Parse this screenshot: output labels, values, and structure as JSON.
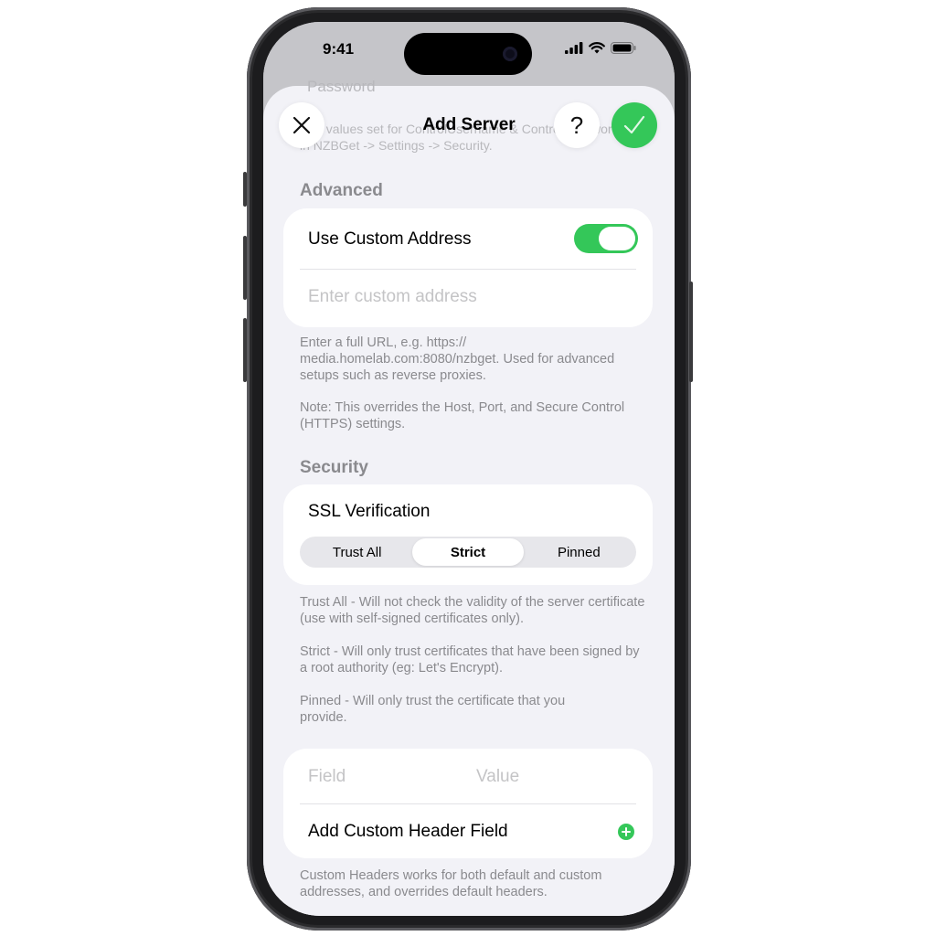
{
  "status_bar": {
    "time": "9:41"
  },
  "behind_sheet": {
    "label": "Password",
    "text": "Use values set for ControlUsername & ControlPassword in NZBGet -> Settings -> Security."
  },
  "nav": {
    "title": "Add Server",
    "close_icon": "close-icon",
    "help_label": "?",
    "confirm_icon": "checkmark-icon"
  },
  "advanced": {
    "header": "Advanced",
    "use_custom_address_label": "Use Custom Address",
    "use_custom_address_on": true,
    "address_placeholder": "Enter custom address",
    "address_value": "",
    "footnote_1": "Enter a full URL, e.g. https:// media.homelab.com:8080/nzbget. Used for advanced setups such as reverse proxies.",
    "footnote_2": "Note: This overrides the Host, Port, and Secure Control (HTTPS) settings."
  },
  "security": {
    "header": "Security",
    "ssl_label": "SSL Verification",
    "options": [
      "Trust All",
      "Strict",
      "Pinned"
    ],
    "selected": "Strict",
    "note_trust_all": "Trust All - Will not check the validity of the server certificate (use with self-signed certificates only).",
    "note_strict": "Strict - Will only trust certificates that have been signed by a root authority (eg: Let's Encrypt).",
    "note_pinned": "Pinned - Will only trust the certificate that you provide."
  },
  "headers": {
    "field_placeholder": "Field",
    "value_placeholder": "Value",
    "add_label": "Add Custom Header Field",
    "footnote": "Custom Headers works for both default and custom addresses, and overrides default headers."
  },
  "colors": {
    "accent": "#34c759",
    "background": "#f2f2f7",
    "secondary_text": "#8a8a8e"
  }
}
